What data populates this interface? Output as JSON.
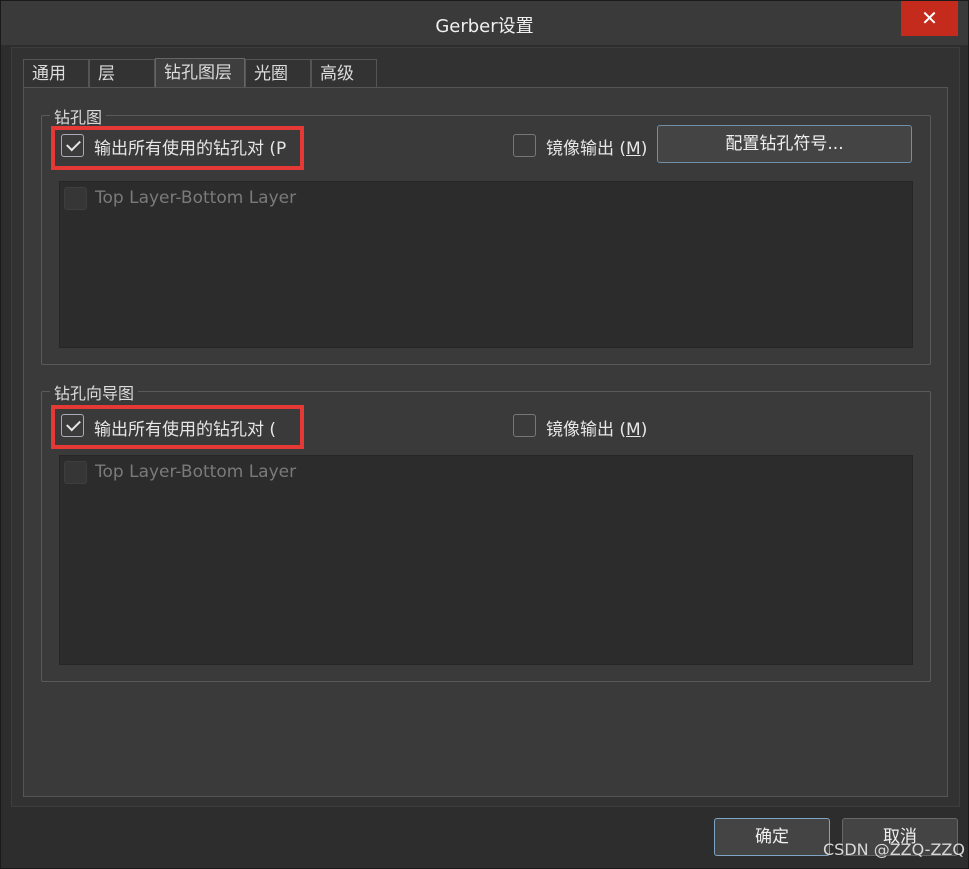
{
  "window": {
    "title": "Gerber设置",
    "close_glyph": "✕"
  },
  "tabs": [
    {
      "label": "通用"
    },
    {
      "label": "层"
    },
    {
      "label": "钻孔图层",
      "active": true
    },
    {
      "label": "光圈"
    },
    {
      "label": "高级"
    }
  ],
  "drill_drawing": {
    "group_label": "钻孔图",
    "plot_all_pairs": {
      "label": "输出所有使用的钻孔对 (P",
      "checked": true
    },
    "mirror": {
      "label_prefix": "镜像输出 (",
      "mnemonic": "M",
      "label_suffix": ")",
      "checked": false
    },
    "config_button": "配置钻孔符号...",
    "layer_pairs": [
      {
        "label": "Top Layer-Bottom Layer",
        "checked": false,
        "enabled": false
      }
    ]
  },
  "drill_guide": {
    "group_label": "钻孔向导图",
    "plot_all_pairs": {
      "label": "输出所有使用的钻孔对 (",
      "checked": true
    },
    "mirror": {
      "label_prefix": "镜像输出 (",
      "mnemonic": "M",
      "label_suffix": ")",
      "checked": false
    },
    "layer_pairs": [
      {
        "label": "Top Layer-Bottom Layer",
        "checked": false,
        "enabled": false
      }
    ]
  },
  "footer": {
    "ok": "确定",
    "cancel": "取消"
  },
  "watermark": "CSDN @ZZQ-ZZQ",
  "colors": {
    "highlight": "#e53935",
    "close": "#c42b1c",
    "button_border": "#6f8fa8"
  }
}
